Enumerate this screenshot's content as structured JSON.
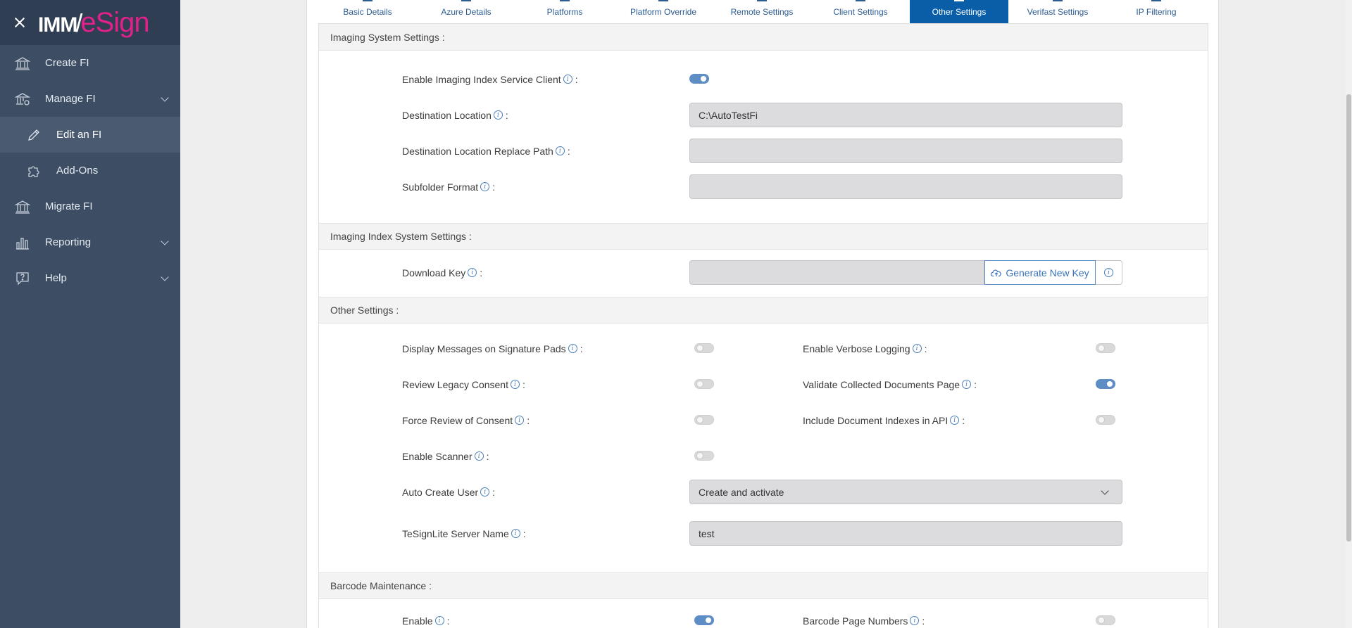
{
  "logo": {
    "part1": "IMM",
    "slash": "/",
    "part2": "eSign"
  },
  "sidebar": {
    "items": [
      {
        "label": "Create FI",
        "icon": "bank-icon"
      },
      {
        "label": "Manage FI",
        "icon": "bank-gear-icon"
      },
      {
        "label": "Edit an FI",
        "icon": "pencil-icon"
      },
      {
        "label": "Add-Ons",
        "icon": "puzzle-icon"
      },
      {
        "label": "Migrate FI",
        "icon": "bank-arrow-icon"
      },
      {
        "label": "Reporting",
        "icon": "bar-chart-icon"
      },
      {
        "label": "Help",
        "icon": "help-icon"
      }
    ]
  },
  "tabs": [
    {
      "label": "Basic Details"
    },
    {
      "label": "Azure Details"
    },
    {
      "label": "Platforms"
    },
    {
      "label": "Platform Override"
    },
    {
      "label": "Remote Settings"
    },
    {
      "label": "Client Settings"
    },
    {
      "label": "Other Settings"
    },
    {
      "label": "Verifast Settings"
    },
    {
      "label": "IP Filtering"
    }
  ],
  "imaging": {
    "title": "Imaging System Settings :",
    "enable_label": "Enable Imaging Index Service Client",
    "enable_on": true,
    "dest_label": "Destination Location",
    "dest_value": "C:\\AutoTestFi",
    "replace_label": "Destination Location Replace Path",
    "replace_value": "",
    "subfolder_label": "Subfolder Format",
    "subfolder_value": ""
  },
  "index": {
    "title": "Imaging Index System Settings :",
    "download_label": "Download Key",
    "download_value": "",
    "generate_label": "Generate New Key"
  },
  "other": {
    "title": "Other Settings :",
    "display_label": "Display Messages on Signature Pads",
    "display_on": false,
    "verbose_label": "Enable Verbose Logging",
    "verbose_on": false,
    "legacy_label": "Review Legacy Consent",
    "legacy_on": false,
    "validate_label": "Validate Collected Documents Page",
    "validate_on": true,
    "force_label": "Force Review of Consent",
    "force_on": false,
    "indexes_label": "Include Document Indexes in API",
    "indexes_on": false,
    "scanner_label": "Enable Scanner",
    "scanner_on": false,
    "autocreate_label": "Auto Create User",
    "autocreate_value": "Create and activate",
    "tesign_label": "TeSignLite Server Name",
    "tesign_value": "test"
  },
  "barcode": {
    "title": "Barcode Maintenance :",
    "enable_label": "Enable",
    "enable_on": true,
    "pages_label": "Barcode Page Numbers",
    "pages_on": false
  },
  "colon": ":",
  "info_glyph": "i",
  "colors": {
    "sidebar": "#3c4d64",
    "accent": "#0a5ea8",
    "magenta": "#e0218a"
  }
}
